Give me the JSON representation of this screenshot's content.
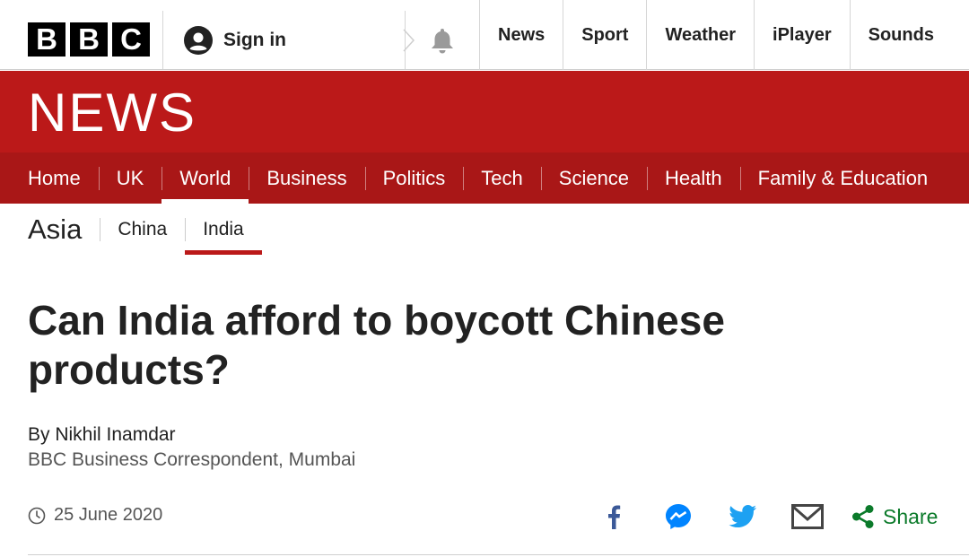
{
  "brand": {
    "logo_letters": [
      "B",
      "B",
      "C"
    ]
  },
  "global_nav": {
    "sign_in_label": "Sign in",
    "items": [
      "News",
      "Sport",
      "Weather",
      "iPlayer",
      "Sounds"
    ]
  },
  "masthead": {
    "title": "NEWS"
  },
  "section_nav": {
    "items": [
      "Home",
      "UK",
      "World",
      "Business",
      "Politics",
      "Tech",
      "Science",
      "Health",
      "Family & Education"
    ],
    "active": "World"
  },
  "sub_nav": {
    "section": "Asia",
    "items": [
      "China",
      "India"
    ],
    "active": "India"
  },
  "article": {
    "headline": "Can India afford to boycott Chinese products?",
    "byline_name": "By Nikhil Inamdar",
    "byline_role": "BBC Business Correspondent, Mumbai",
    "date": "25 June 2020"
  },
  "share": {
    "label": "Share",
    "icons": [
      "facebook-icon",
      "messenger-icon",
      "twitter-icon",
      "email-icon"
    ]
  },
  "colors": {
    "brand_red": "#bb1919",
    "nav_red": "#a91717",
    "facebook": "#3b5998",
    "messenger": "#0084ff",
    "twitter": "#1da1f2",
    "share_green": "#0b7a2a"
  }
}
